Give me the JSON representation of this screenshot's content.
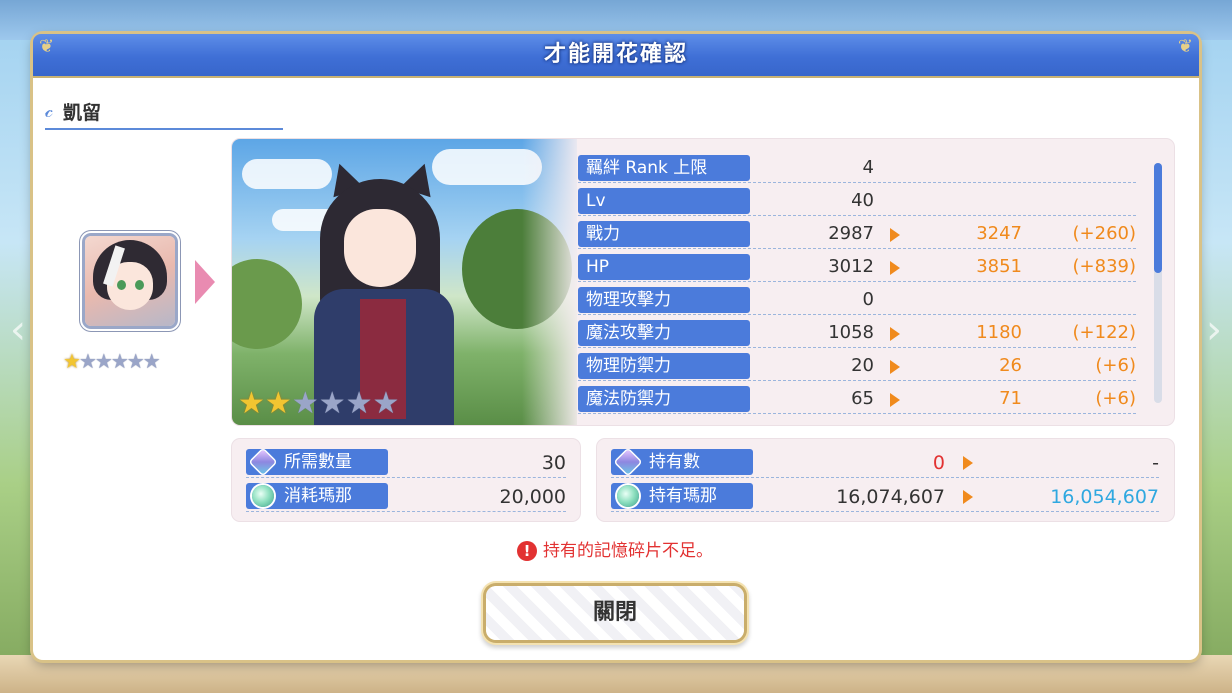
{
  "dialog": {
    "title": "才能開花確認",
    "character_name": "凱留",
    "close_label": "關閉"
  },
  "character": {
    "current_star_level": 1,
    "max_stars": 6,
    "next_star_level": 2
  },
  "stats": [
    {
      "label": "羈絆 Rank 上限",
      "current": "4",
      "new": "",
      "diff": ""
    },
    {
      "label": "Lv",
      "current": "40",
      "new": "",
      "diff": ""
    },
    {
      "label": "戰力",
      "current": "2987",
      "new": "3247",
      "diff": "(+260)"
    },
    {
      "label": "HP",
      "current": "3012",
      "new": "3851",
      "diff": "(+839)"
    },
    {
      "label": "物理攻擊力",
      "current": "0",
      "new": "",
      "diff": ""
    },
    {
      "label": "魔法攻擊力",
      "current": "1058",
      "new": "1180",
      "diff": "(+122)"
    },
    {
      "label": "物理防禦力",
      "current": "20",
      "new": "26",
      "diff": "(+6)"
    },
    {
      "label": "魔法防禦力",
      "current": "65",
      "new": "71",
      "diff": "(+6)"
    }
  ],
  "cost": {
    "required_label": "所需數量",
    "required_value": "30",
    "mana_cost_label": "消耗瑪那",
    "mana_cost_value": "20,000"
  },
  "owned": {
    "count_label": "持有數",
    "count_value": "0",
    "count_after": "-",
    "mana_label": "持有瑪那",
    "mana_value": "16,074,607",
    "mana_after": "16,054,607"
  },
  "warning": "持有的記憶碎片不足。",
  "colors": {
    "header_blue": "#3f6fd6",
    "label_blue": "#4b7bdb",
    "increase_orange": "#f08a1d",
    "warning_red": "#e23232",
    "mana_after_blue": "#2fa8e0",
    "star_gold": "#f2c531"
  }
}
